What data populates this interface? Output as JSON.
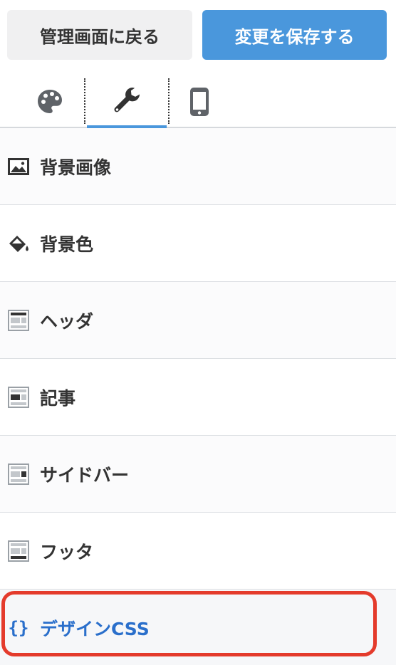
{
  "header": {
    "back_label": "管理画面に戻る",
    "save_label": "変更を保存する"
  },
  "tabs": [
    {
      "name": "theme",
      "icon": "palette-icon"
    },
    {
      "name": "customize",
      "icon": "wrench-icon",
      "active": true
    },
    {
      "name": "mobile",
      "icon": "smartphone-icon"
    }
  ],
  "menu": {
    "items": [
      {
        "label": "背景画像",
        "icon": "image-icon"
      },
      {
        "label": "背景色",
        "icon": "paint-bucket-icon"
      },
      {
        "label": "ヘッダ",
        "icon": "layout-header-icon"
      },
      {
        "label": "記事",
        "icon": "layout-article-icon"
      },
      {
        "label": "サイドバー",
        "icon": "layout-sidebar-icon"
      },
      {
        "label": "フッタ",
        "icon": "layout-footer-icon"
      },
      {
        "label": "デザインCSS",
        "icon": "braces-icon",
        "icon_text": "{}",
        "active": true
      }
    ]
  },
  "colors": {
    "primary": "#4a97dc",
    "active_text": "#2a6fcb",
    "highlight": "#e43b2c"
  }
}
